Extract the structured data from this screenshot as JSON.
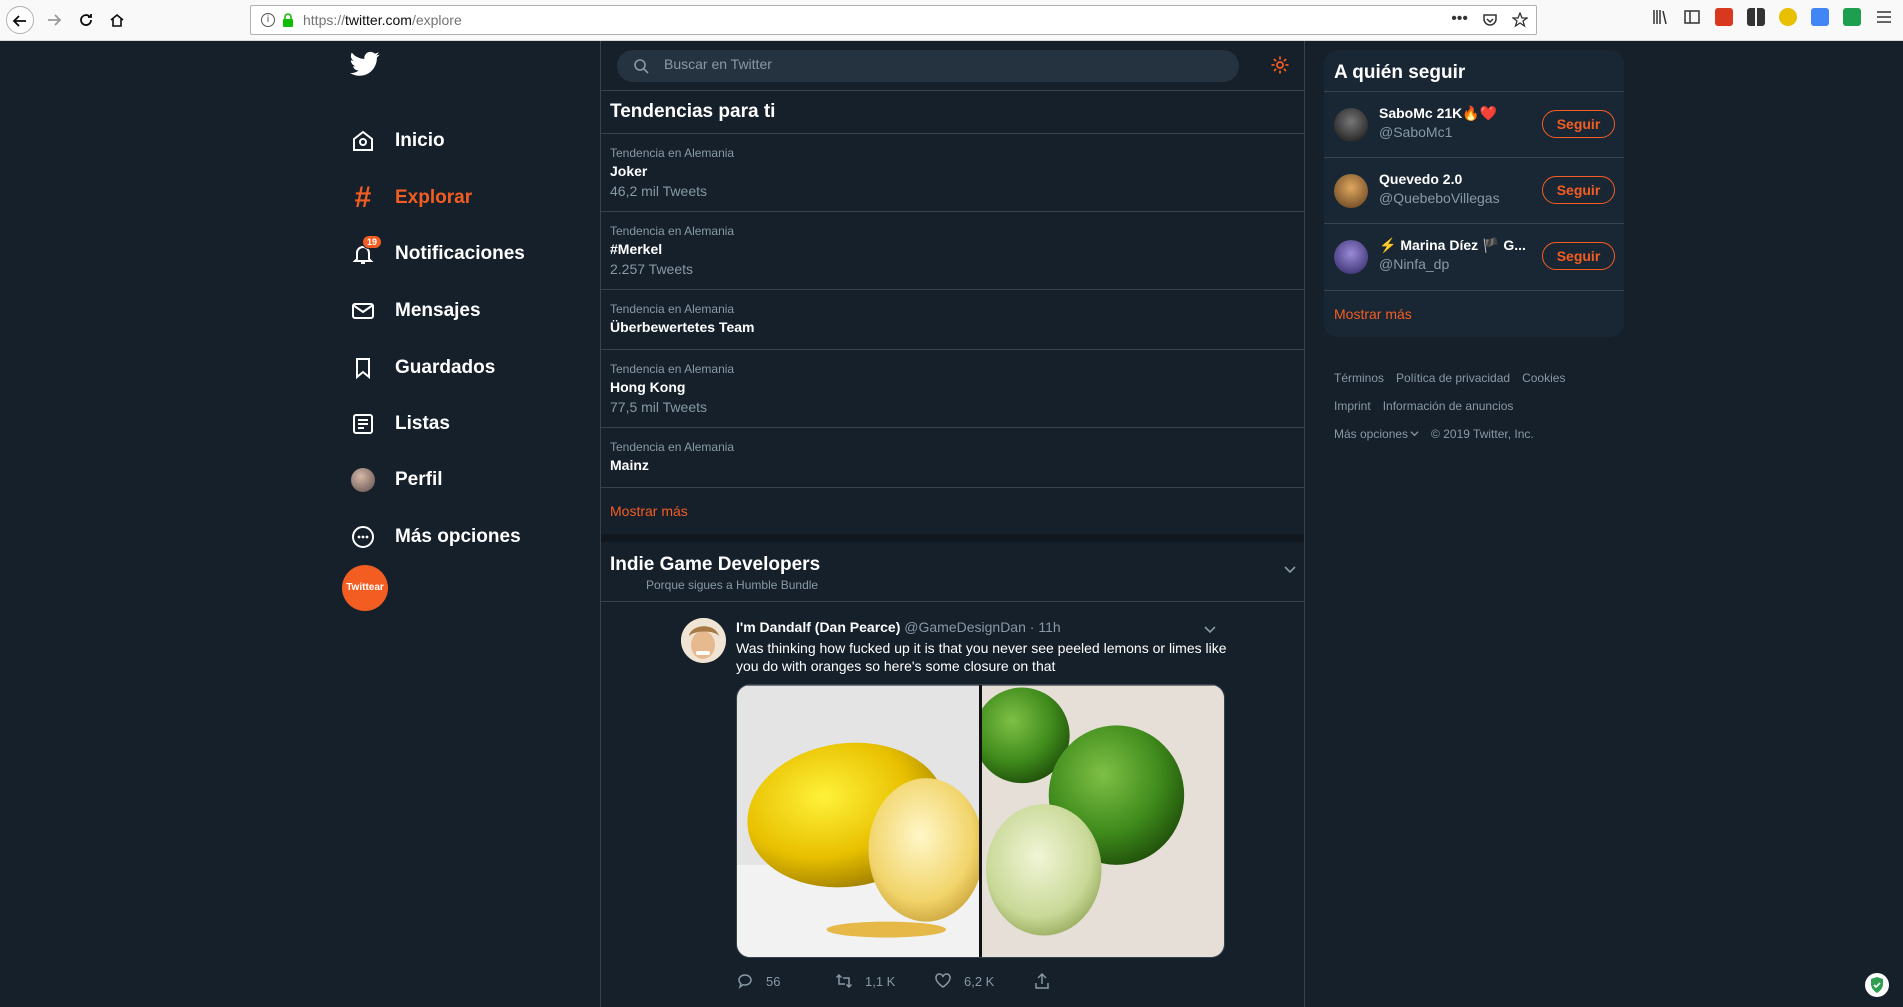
{
  "browser": {
    "url_prefix": "https://",
    "url_host": "twitter.com",
    "url_path": "/explore"
  },
  "nav": {
    "items": [
      {
        "label": "Inicio",
        "icon": "home-icon"
      },
      {
        "label": "Explorar",
        "icon": "hashtag-icon",
        "active": true
      },
      {
        "label": "Notificaciones",
        "icon": "bell-icon",
        "badge": "19"
      },
      {
        "label": "Mensajes",
        "icon": "envelope-icon"
      },
      {
        "label": "Guardados",
        "icon": "bookmark-icon"
      },
      {
        "label": "Listas",
        "icon": "list-icon"
      },
      {
        "label": "Perfil",
        "icon": "avatar"
      },
      {
        "label": "Más opciones",
        "icon": "more-circle-icon"
      }
    ],
    "tweet_button": "Twittear"
  },
  "search": {
    "placeholder": "Buscar en Twitter"
  },
  "trends": {
    "title": "Tendencias para ti",
    "items": [
      {
        "context": "Tendencia en Alemania",
        "name": "Joker",
        "count": "46,2 mil Tweets"
      },
      {
        "context": "Tendencia en Alemania",
        "name": "#Merkel",
        "count": "2.257 Tweets"
      },
      {
        "context": "Tendencia en Alemania",
        "name": "Überbewertetes Team",
        "count": ""
      },
      {
        "context": "Tendencia en Alemania",
        "name": "Hong Kong",
        "count": "77,5 mil Tweets"
      },
      {
        "context": "Tendencia en Alemania",
        "name": "Mainz",
        "count": ""
      }
    ],
    "show_more": "Mostrar más"
  },
  "topic": {
    "title": "Indie Game Developers",
    "reason": "Porque sigues a Humble Bundle"
  },
  "tweet": {
    "name": "I'm Dandalf (Dan Pearce)",
    "handle": "@GameDesignDan",
    "dot": " · ",
    "time": "11h",
    "text": "Was thinking how fucked up it is that you never see peeled lemons or limes like you do with oranges so here's some closure on that",
    "replies": "56",
    "retweets": "1,1 K",
    "likes": "6,2 K"
  },
  "who_to_follow": {
    "title": "A quién seguir",
    "users": [
      {
        "name": "SaboMc 21K🔥❤️",
        "handle": "@SaboMc1",
        "follow": "Seguir"
      },
      {
        "name": "Quevedo 2.0",
        "handle": "@QuebeboVillegas",
        "follow": "Seguir"
      },
      {
        "name": "⚡ Marina Díez 🏴 G...",
        "handle": "@Ninfa_dp",
        "follow": "Seguir"
      }
    ],
    "show_more": "Mostrar más"
  },
  "footer": {
    "terms": "Términos",
    "privacy": "Política de privacidad",
    "cookies": "Cookies",
    "imprint": "Imprint",
    "ads_info": "Información de anuncios",
    "more_options": "Más opciones",
    "copyright": "© 2019 Twitter, Inc."
  },
  "colors": {
    "accent": "#f45d22",
    "background": "#15202b",
    "card": "#192734",
    "border": "#38444d",
    "muted": "#8899a6"
  }
}
